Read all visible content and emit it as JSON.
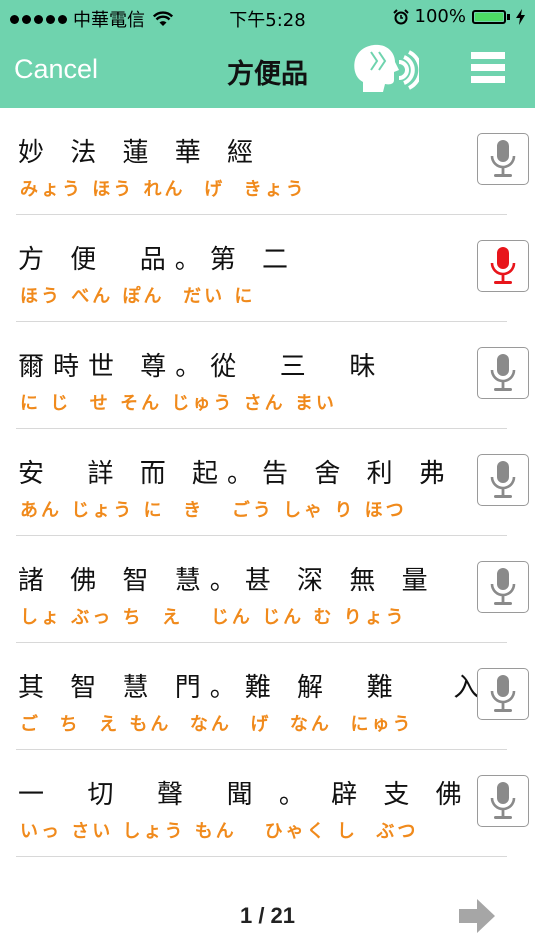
{
  "status_bar": {
    "carrier": "中華電信",
    "time": "下午5:28",
    "battery": "100%",
    "battery_color": "#4cd964"
  },
  "nav": {
    "cancel_label": "Cancel",
    "title": "方便品",
    "speak_icon": "speaking-head-icon",
    "menu_icon": "hamburger-menu-icon",
    "bar_color": "#6fd3ae"
  },
  "verses": [
    {
      "kanji": "妙 法 蓮 華 經",
      "kana": "みょう ほう れん  げ  きょう",
      "mic_active": false
    },
    {
      "kanji": "方 便  品。第 二",
      "kana": "ほう べん ぽん  だい に",
      "mic_active": true
    },
    {
      "kanji": "爾時世 尊。從  三  昧",
      "kana": "に じ  せ そん じゅう さん まい",
      "mic_active": false
    },
    {
      "kanji": "安  詳 而 起。告 舍 利 弗",
      "kana": "あん じょう に  き   ごう しゃ り ほつ",
      "mic_active": false
    },
    {
      "kanji": "諸 佛 智 慧。甚 深 無 量",
      "kana": "しょ ぶっ ち  え   じん じん む りょう",
      "mic_active": false
    },
    {
      "kanji": "其 智 慧 門。難 解  難   入",
      "kana": "ご  ち  え もん  なん  げ  なん  にゅう",
      "mic_active": false
    },
    {
      "kanji": "一  切  聲  聞 。 辟 支 佛",
      "kana": "いっ さい しょう もん   ひゃく し  ぶつ",
      "mic_active": false
    }
  ],
  "mic_icon": "microphone-icon",
  "mic_colors": {
    "inactive": "#8a8a8a",
    "active": "#e8151b"
  },
  "pager": {
    "label": "1 / 21",
    "next_icon": "right-arrow-icon"
  },
  "accent_kana_color": "#f08a1c"
}
